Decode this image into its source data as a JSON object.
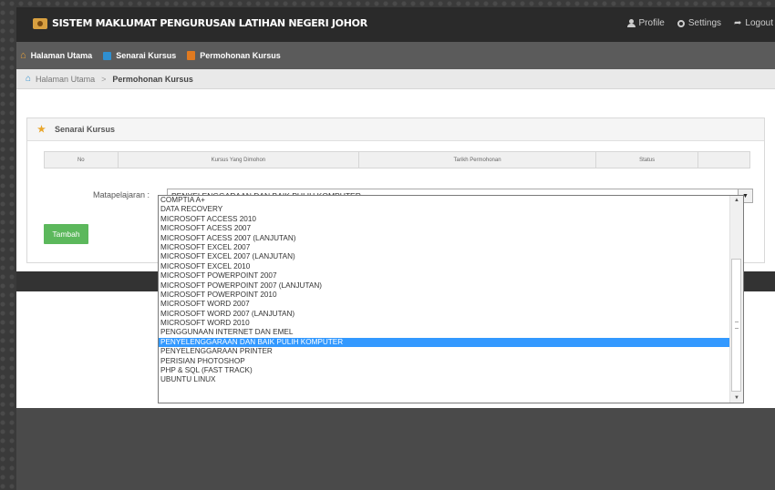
{
  "app": {
    "title": "SISTEM MAKLUMAT PENGURUSAN LATIHAN NEGERI JOHOR",
    "logo_icon": "crest-icon"
  },
  "top_actions": {
    "profile": "Profile",
    "settings": "Settings",
    "logout": "Logout"
  },
  "nav": {
    "items": [
      "Halaman Utama",
      "Senarai Kursus",
      "Permohonan Kursus"
    ]
  },
  "breadcrumb": {
    "home": "Halaman Utama",
    "separator": ">",
    "current": "Permohonan Kursus"
  },
  "panel": {
    "title": "Senarai Kursus"
  },
  "table": {
    "headers": [
      "No",
      "Kursus Yang Dimohon",
      "Tarikh Permohonan",
      "Status",
      ""
    ]
  },
  "form": {
    "label": "Matapelajaran :",
    "selected": "PENYELENGGARAAN DAN BAIK PULIH KOMPUTER",
    "add_button": "Tambah"
  },
  "dropdown": {
    "options": [
      "COMPTIA A+",
      "DATA RECOVERY",
      "MICROSOFT ACCESS 2010",
      "MICROSOFT ACESS 2007",
      "MICROSOFT ACESS 2007 (LANJUTAN)",
      "MICROSOFT EXCEL 2007",
      "MICROSOFT EXCEL 2007 (LANJUTAN)",
      "MICROSOFT EXCEL 2010",
      "MICROSOFT POWERPOINT 2007",
      "MICROSOFT POWERPOINT 2007 (LANJUTAN)",
      "MICROSOFT POWERPOINT 2010",
      "MICROSOFT WORD 2007",
      "MICROSOFT WORD 2007 (LANJUTAN)",
      "MICROSOFT WORD 2010",
      "PENGGUNAAN INTERNET DAN EMEL",
      "PENYELENGGARAAN DAN BAIK PULIH KOMPUTER",
      "PENYELENGGARAAN PRINTER",
      "PERISIAN PHOTOSHOP",
      "PHP & SQL (FAST TRACK)",
      "UBUNTU LINUX"
    ],
    "highlighted_index": 15
  },
  "colors": {
    "accent_green": "#5cb85c",
    "highlight_blue": "#3399ff",
    "topbar": "#2a2a2a",
    "navbar": "#5b5b5b"
  }
}
